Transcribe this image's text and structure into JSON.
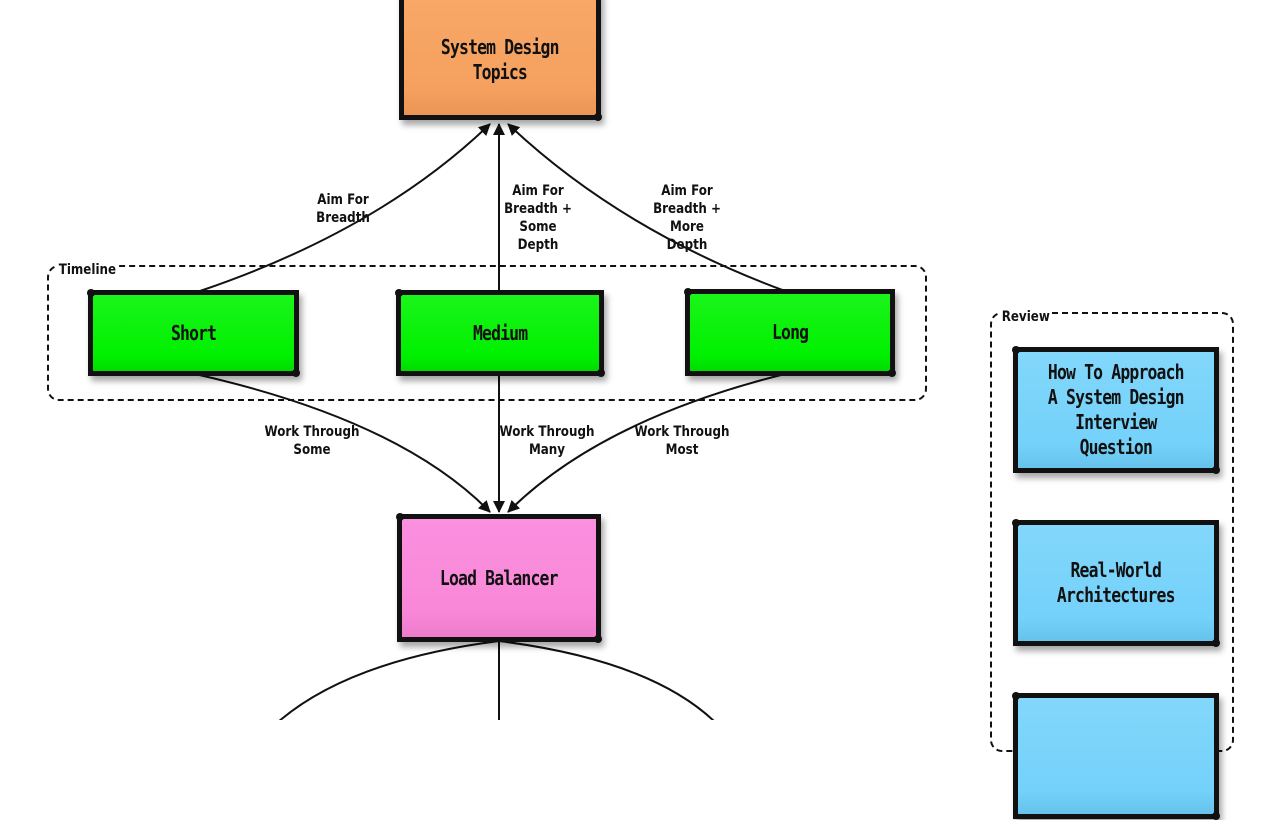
{
  "diagram": {
    "nodes": {
      "system_design_topics": {
        "label": "System Design\nTopics",
        "color": "#f5a05e"
      },
      "short": {
        "label": "Short",
        "color": "#00f000"
      },
      "medium": {
        "label": "Medium",
        "color": "#00f000"
      },
      "long": {
        "label": "Long",
        "color": "#00f000"
      },
      "load_balancer": {
        "label": "Load Balancer",
        "color": "#f987d8"
      },
      "how_to_approach": {
        "label": "How To Approach\nA System Design\nInterview\nQuestion",
        "color": "#74d1fa"
      },
      "real_world_architectures": {
        "label": "Real-World\nArchitectures",
        "color": "#74d1fa"
      },
      "review_third": {
        "label": "",
        "color": "#74d1fa"
      }
    },
    "groups": {
      "timeline": {
        "label": "Timeline"
      },
      "review": {
        "label": "Review"
      }
    },
    "edges": [
      {
        "from": "short",
        "to": "system_design_topics",
        "label": "Aim For\nBreadth"
      },
      {
        "from": "medium",
        "to": "system_design_topics",
        "label": "Aim For\nBreadth +\nSome Depth"
      },
      {
        "from": "long",
        "to": "system_design_topics",
        "label": "Aim For\nBreadth +\nMore Depth"
      },
      {
        "from": "short",
        "to": "load_balancer",
        "label": "Work Through\nSome"
      },
      {
        "from": "medium",
        "to": "load_balancer",
        "label": "Work Through\nMany"
      },
      {
        "from": "long",
        "to": "load_balancer",
        "label": "Work Through\nMost"
      },
      {
        "from": "load_balancer",
        "to": "offscreen-left",
        "label": ""
      },
      {
        "from": "load_balancer",
        "to": "offscreen-center",
        "label": ""
      },
      {
        "from": "load_balancer",
        "to": "offscreen-right",
        "label": ""
      }
    ]
  }
}
